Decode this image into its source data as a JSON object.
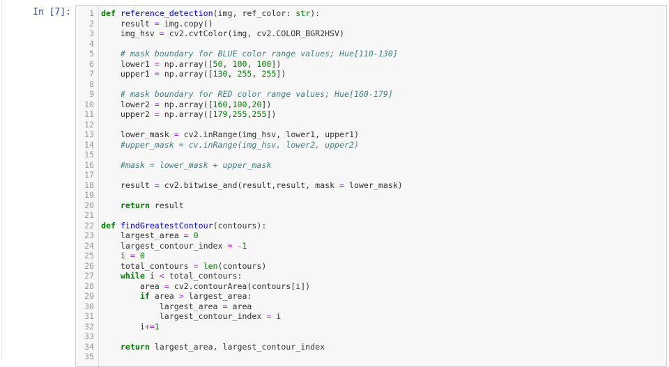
{
  "prompt": "In [7]:",
  "code_lines": [
    [
      {
        "t": "kw",
        "v": "def"
      },
      {
        "t": "",
        "v": " "
      },
      {
        "t": "def",
        "v": "reference_detection"
      },
      {
        "t": "",
        "v": "(img, ref_color: "
      },
      {
        "t": "bi",
        "v": "str"
      },
      {
        "t": "",
        "v": "):"
      }
    ],
    [
      {
        "t": "",
        "v": "    result "
      },
      {
        "t": "op",
        "v": "="
      },
      {
        "t": "",
        "v": " img.copy()"
      }
    ],
    [
      {
        "t": "",
        "v": "    img_hsv "
      },
      {
        "t": "op",
        "v": "="
      },
      {
        "t": "",
        "v": " cv2.cvtColor(img, cv2.COLOR_BGR2HSV)"
      }
    ],
    [],
    [
      {
        "t": "",
        "v": "    "
      },
      {
        "t": "cm",
        "v": "# mask boundary for BLUE color range values; Hue[110-130]"
      }
    ],
    [
      {
        "t": "",
        "v": "    lower1 "
      },
      {
        "t": "op",
        "v": "="
      },
      {
        "t": "",
        "v": " np.array(["
      },
      {
        "t": "num",
        "v": "50"
      },
      {
        "t": "",
        "v": ", "
      },
      {
        "t": "num",
        "v": "100"
      },
      {
        "t": "",
        "v": ", "
      },
      {
        "t": "num",
        "v": "100"
      },
      {
        "t": "",
        "v": "])"
      }
    ],
    [
      {
        "t": "",
        "v": "    upper1 "
      },
      {
        "t": "op",
        "v": "="
      },
      {
        "t": "",
        "v": " np.array(["
      },
      {
        "t": "num",
        "v": "130"
      },
      {
        "t": "",
        "v": ", "
      },
      {
        "t": "num",
        "v": "255"
      },
      {
        "t": "",
        "v": ", "
      },
      {
        "t": "num",
        "v": "255"
      },
      {
        "t": "",
        "v": "])"
      }
    ],
    [],
    [
      {
        "t": "",
        "v": "    "
      },
      {
        "t": "cm",
        "v": "# mask boundary for RED color range values; Hue[160-179]"
      }
    ],
    [
      {
        "t": "",
        "v": "    lower2 "
      },
      {
        "t": "op",
        "v": "="
      },
      {
        "t": "",
        "v": " np.array(["
      },
      {
        "t": "num",
        "v": "160"
      },
      {
        "t": "",
        "v": ","
      },
      {
        "t": "num",
        "v": "100"
      },
      {
        "t": "",
        "v": ","
      },
      {
        "t": "num",
        "v": "20"
      },
      {
        "t": "",
        "v": "])"
      }
    ],
    [
      {
        "t": "",
        "v": "    upper2 "
      },
      {
        "t": "op",
        "v": "="
      },
      {
        "t": "",
        "v": " np.array(["
      },
      {
        "t": "num",
        "v": "179"
      },
      {
        "t": "",
        "v": ","
      },
      {
        "t": "num",
        "v": "255"
      },
      {
        "t": "",
        "v": ","
      },
      {
        "t": "num",
        "v": "255"
      },
      {
        "t": "",
        "v": "])"
      }
    ],
    [],
    [
      {
        "t": "",
        "v": "    lower_mask "
      },
      {
        "t": "op",
        "v": "="
      },
      {
        "t": "",
        "v": " cv2.inRange(img_hsv, lower1, upper1)"
      }
    ],
    [
      {
        "t": "",
        "v": "    "
      },
      {
        "t": "cm",
        "v": "#upper_mask = cv.inRange(img_hsv, lower2, upper2)"
      }
    ],
    [],
    [
      {
        "t": "",
        "v": "    "
      },
      {
        "t": "cm",
        "v": "#mask = lower_mask + upper_mask"
      }
    ],
    [],
    [
      {
        "t": "",
        "v": "    result "
      },
      {
        "t": "op",
        "v": "="
      },
      {
        "t": "",
        "v": " cv2.bitwise_and(result,result, mask "
      },
      {
        "t": "op",
        "v": "="
      },
      {
        "t": "",
        "v": " lower_mask)"
      }
    ],
    [],
    [
      {
        "t": "",
        "v": "    "
      },
      {
        "t": "kw",
        "v": "return"
      },
      {
        "t": "",
        "v": " result"
      }
    ],
    [],
    [
      {
        "t": "kw",
        "v": "def"
      },
      {
        "t": "",
        "v": " "
      },
      {
        "t": "def",
        "v": "findGreatestContour"
      },
      {
        "t": "",
        "v": "(contours):"
      }
    ],
    [
      {
        "t": "",
        "v": "    largest_area "
      },
      {
        "t": "op",
        "v": "="
      },
      {
        "t": "",
        "v": " "
      },
      {
        "t": "num",
        "v": "0"
      }
    ],
    [
      {
        "t": "",
        "v": "    largest_contour_index "
      },
      {
        "t": "op",
        "v": "="
      },
      {
        "t": "",
        "v": " "
      },
      {
        "t": "op",
        "v": "-"
      },
      {
        "t": "num",
        "v": "1"
      }
    ],
    [
      {
        "t": "",
        "v": "    i "
      },
      {
        "t": "op",
        "v": "="
      },
      {
        "t": "",
        "v": " "
      },
      {
        "t": "num",
        "v": "0"
      }
    ],
    [
      {
        "t": "",
        "v": "    total_contours "
      },
      {
        "t": "op",
        "v": "="
      },
      {
        "t": "",
        "v": " "
      },
      {
        "t": "bi",
        "v": "len"
      },
      {
        "t": "",
        "v": "(contours)"
      }
    ],
    [
      {
        "t": "",
        "v": "    "
      },
      {
        "t": "kw",
        "v": "while"
      },
      {
        "t": "",
        "v": " i "
      },
      {
        "t": "op",
        "v": "<"
      },
      {
        "t": "",
        "v": " total_contours:"
      }
    ],
    [
      {
        "t": "",
        "v": "        area "
      },
      {
        "t": "op",
        "v": "="
      },
      {
        "t": "",
        "v": " cv2.contourArea(contours[i])"
      }
    ],
    [
      {
        "t": "",
        "v": "        "
      },
      {
        "t": "kw",
        "v": "if"
      },
      {
        "t": "",
        "v": " area "
      },
      {
        "t": "op",
        "v": ">"
      },
      {
        "t": "",
        "v": " largest_area:"
      }
    ],
    [
      {
        "t": "",
        "v": "            largest_area "
      },
      {
        "t": "op",
        "v": "="
      },
      {
        "t": "",
        "v": " area"
      }
    ],
    [
      {
        "t": "",
        "v": "            largest_contour_index "
      },
      {
        "t": "op",
        "v": "="
      },
      {
        "t": "",
        "v": " i"
      }
    ],
    [
      {
        "t": "",
        "v": "        i"
      },
      {
        "t": "op",
        "v": "+="
      },
      {
        "t": "num",
        "v": "1"
      }
    ],
    [],
    [
      {
        "t": "",
        "v": "    "
      },
      {
        "t": "kw",
        "v": "return"
      },
      {
        "t": "",
        "v": " largest_area, largest_contour_index"
      }
    ],
    []
  ]
}
